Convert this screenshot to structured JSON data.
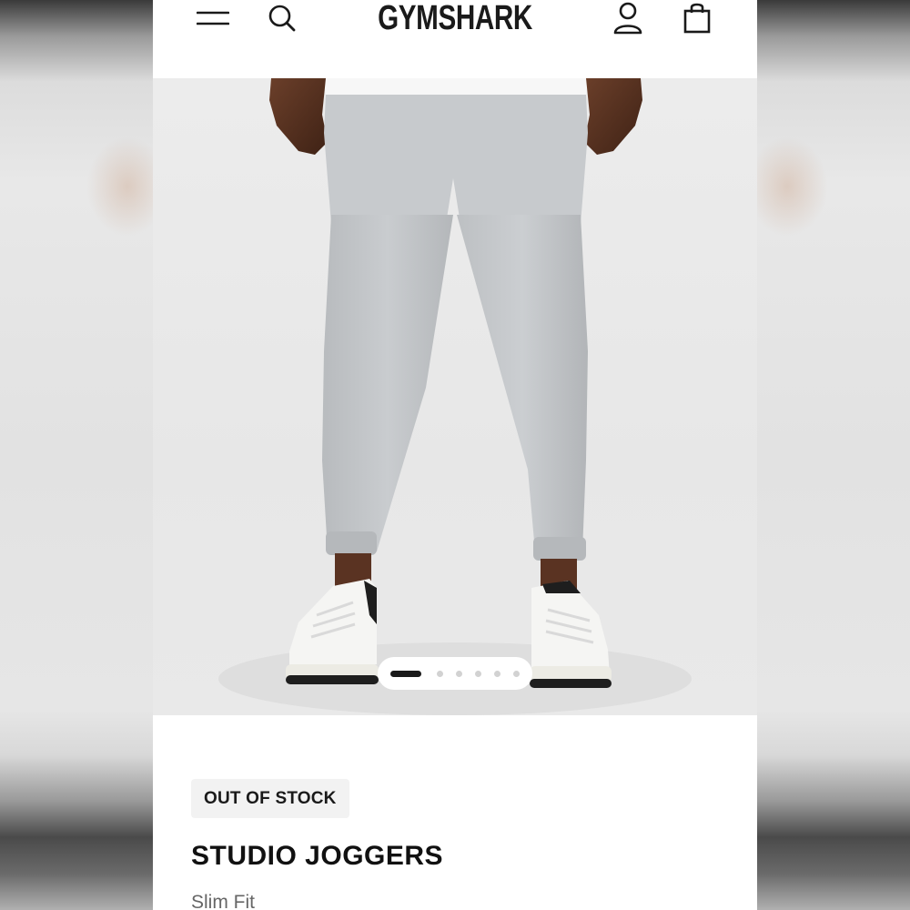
{
  "header": {
    "logo_text": "GYMSHARK",
    "icons": [
      "menu-icon",
      "search-icon",
      "account-icon",
      "bag-icon"
    ]
  },
  "gallery": {
    "image_count": 6,
    "active_index": 0
  },
  "product": {
    "stock_badge": "OUT OF STOCK",
    "title": "STUDIO JOGGERS",
    "fit": "Slim Fit"
  },
  "colors": {
    "brand_text": "#1a1a1a",
    "badge_bg": "#f2f2f2",
    "trouser_grey": "#c4c7ca"
  }
}
